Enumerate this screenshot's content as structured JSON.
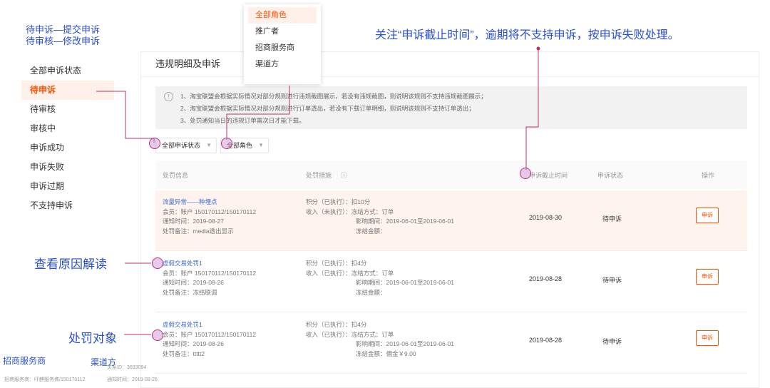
{
  "annotations": {
    "top_line1": "待申诉—提交申诉",
    "top_line2": "待审核—修改申诉",
    "deadline_note": "关注“申诉截止时间”，逾期将不支持申诉，按申诉失败处理。",
    "reason_note": "查看原因解读",
    "target_note": "处罚对象",
    "merchant": "招商服务商",
    "channel": "渠道方"
  },
  "status_list": [
    {
      "label": "全部申诉状态"
    },
    {
      "label": "待申诉"
    },
    {
      "label": "待审核"
    },
    {
      "label": "审核中"
    },
    {
      "label": "申诉成功"
    },
    {
      "label": "申诉失败"
    },
    {
      "label": "申诉过期"
    },
    {
      "label": "不支持申诉"
    }
  ],
  "card": {
    "title": "违规明细及申诉",
    "info": [
      "1、淘宝联盟会根据实际情况对部分规则进行违规截图展示，若没有违规截图，则说明该规则不支持违规截图展示；",
      "2、淘宝联盟会根据实际情况对部分规则进行订单透出，若没有下载订单明细，则说明该规则不支持订单透出；",
      "3、处罚通知当日的违规订单需次日才能下载。"
    ],
    "filter_status": "全部申诉状态",
    "filter_role": "全部角色",
    "headers": {
      "info": "处罚信息",
      "measure": "处罚措施",
      "deadline": "申诉截止时间",
      "state": "申诉状态",
      "action": "操作"
    }
  },
  "rows": [
    {
      "title": "流量异常——种埋点",
      "member": "会员：账户 150170112/150170112",
      "notice": "通知时间：2019-08-27",
      "remark": "处罚备注：media透出显示",
      "points": "积分（已执行）：扣10分",
      "income": "收入（未执行）：冻结方式：订单",
      "period": "影响期间：2019-06-01至2019-06-01",
      "amount": "冻结金额：",
      "deadline": "2019-08-30",
      "state": "待申诉",
      "button": "申诉"
    },
    {
      "title": "虚假交易处罚1",
      "member": "会员：账户 150170112/150170112",
      "notice": "通知时间：2019-08-26",
      "remark": "处罚备注：冻结联调",
      "points": "积分（已执行）：扣4分",
      "income": "收入（已执行）：冻结方式：订单",
      "period": "影响期间：2019-06-01至2019-06-01",
      "amount": "冻结金额：",
      "deadline": "2019-08-28",
      "state": "待申诉",
      "button": "申诉"
    },
    {
      "title": "虚假交易处罚1",
      "member": "会员：账户 150170112/150170112",
      "notice": "通知时间：2019-08-26",
      "remark": "处罚备注：ttttt2",
      "points": "积分（已执行）：扣4分",
      "income": "收入（已执行）：冻结方式：订单",
      "period": "影响期间：2019-06-01至2019-06-01",
      "amount": "冻结金额：佣金￥9.00",
      "deadline": "2019-08-28",
      "state": "待申诉",
      "button": "申诉"
    }
  ],
  "dropdown": {
    "items": [
      "全部角色",
      "推广者",
      "招商服务商",
      "渠道方"
    ]
  },
  "footer": {
    "id_text": "关系ID：3693094",
    "merchant_text": "招商服务商：吓麒服务商/150170112",
    "notice_text": "通知时间：2019-08-26"
  },
  "colors": {
    "accent": "#ff5000",
    "annotation": "#2a4fd1",
    "marker": "#c0306a"
  }
}
